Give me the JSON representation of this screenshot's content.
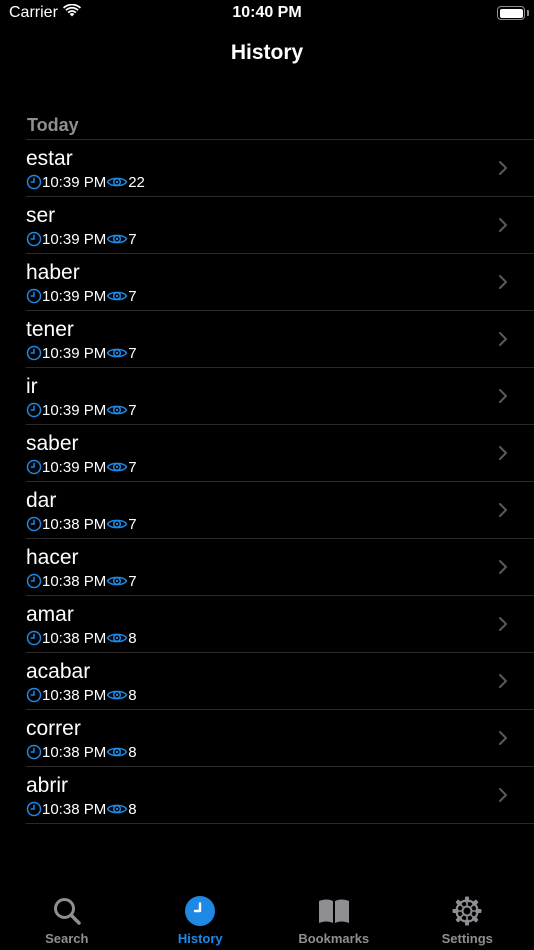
{
  "status_bar": {
    "carrier": "Carrier",
    "time": "10:40 PM",
    "battery_level": 1.0
  },
  "nav": {
    "title": "History"
  },
  "section": {
    "header": "Today"
  },
  "rows": [
    {
      "word": "estar",
      "time": "10:39 PM",
      "views": "22"
    },
    {
      "word": "ser",
      "time": "10:39 PM",
      "views": "7"
    },
    {
      "word": "haber",
      "time": "10:39 PM",
      "views": "7"
    },
    {
      "word": "tener",
      "time": "10:39 PM",
      "views": "7"
    },
    {
      "word": "ir",
      "time": "10:39 PM",
      "views": "7"
    },
    {
      "word": "saber",
      "time": "10:39 PM",
      "views": "7"
    },
    {
      "word": "dar",
      "time": "10:38 PM",
      "views": "7"
    },
    {
      "word": "hacer",
      "time": "10:38 PM",
      "views": "7"
    },
    {
      "word": "amar",
      "time": "10:38 PM",
      "views": "8"
    },
    {
      "word": "acabar",
      "time": "10:38 PM",
      "views": "8"
    },
    {
      "word": "correr",
      "time": "10:38 PM",
      "views": "8"
    },
    {
      "word": "abrir",
      "time": "10:38 PM",
      "views": "8"
    }
  ],
  "tabs": [
    {
      "label": "Search",
      "icon": "search-icon",
      "active": false
    },
    {
      "label": "History",
      "icon": "clock-icon",
      "active": true
    },
    {
      "label": "Bookmarks",
      "icon": "book-icon",
      "active": false
    },
    {
      "label": "Settings",
      "icon": "gear-icon",
      "active": false
    }
  ],
  "colors": {
    "accent": "#1e88e5",
    "inactive": "#8e8e93",
    "background": "#000000"
  }
}
